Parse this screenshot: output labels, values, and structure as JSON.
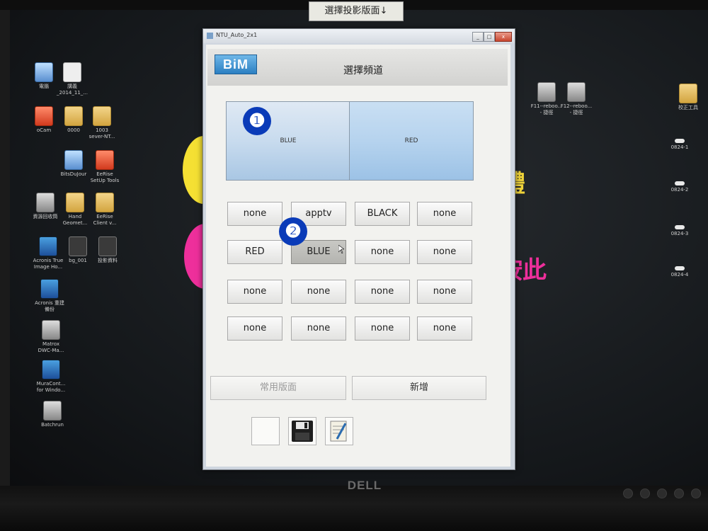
{
  "sticky_note": "選擇投影版面↓",
  "desktop_icons": [
    {
      "name": "computer-icon",
      "label": "電腦",
      "glyph": "g-pc"
    },
    {
      "name": "doc-icon",
      "label": "講義\n_2014_11_...",
      "glyph": "g-doc"
    },
    {
      "name": "ocam-icon",
      "label": "oCam",
      "glyph": "g-red"
    },
    {
      "name": "folder-icon",
      "label": "0000",
      "glyph": "g-folder"
    },
    {
      "name": "folder-icon",
      "label": "1003\nsever-NT...",
      "glyph": "g-folder"
    },
    {
      "name": "app-icon",
      "label": "BitsDuJour",
      "glyph": "g-pc"
    },
    {
      "name": "app-icon",
      "label": "EeRise\nSetUp Tools",
      "glyph": "g-red"
    },
    {
      "name": "recycle-bin-icon",
      "label": "資源回收筒",
      "glyph": "g-app"
    },
    {
      "name": "folder-icon",
      "label": "Hand\nGeomet...",
      "glyph": "g-folder"
    },
    {
      "name": "folder-icon",
      "label": "EeRise\nClient v...",
      "glyph": "g-folder"
    },
    {
      "name": "acronis-icon",
      "label": "Acronis True\nImage Ho...",
      "glyph": "g-blue"
    },
    {
      "name": "app-icon",
      "label": "bg_001",
      "glyph": "g-dark"
    },
    {
      "name": "app-icon",
      "label": "投影資料",
      "glyph": "g-dark"
    },
    {
      "name": "acronis-icon",
      "label": "Acronis 重建\n備份",
      "glyph": "g-blue"
    },
    {
      "name": "matrox-icon",
      "label": "Matrox\nDWC-Ma...",
      "glyph": "g-app"
    },
    {
      "name": "muracontrol-icon",
      "label": "MuraCont...\nfor Windo...",
      "glyph": "g-blue"
    },
    {
      "name": "batch-icon",
      "label": "Batchrun",
      "glyph": "g-app"
    },
    {
      "name": "shortcut-icon",
      "label": "F11--reboo...\n- 捷徑",
      "glyph": "g-app"
    },
    {
      "name": "shortcut-icon",
      "label": "F12--reboo...\n- 捷徑",
      "glyph": "g-app"
    },
    {
      "name": "folder-icon",
      "label": "校正工具",
      "glyph": "g-folder"
    },
    {
      "name": "file-icon",
      "label": "0824-1",
      "glyph": "g-bar"
    },
    {
      "name": "file-icon",
      "label": "0824-2",
      "glyph": "g-bar"
    },
    {
      "name": "file-icon",
      "label": "0824-3",
      "glyph": "g-bar"
    },
    {
      "name": "file-icon",
      "label": "0824-4",
      "glyph": "g-bar"
    }
  ],
  "wallpaper": {
    "text_1": "體",
    "text_2": "按此"
  },
  "window": {
    "title": "NTU_Auto_2x1",
    "logo": "BiM",
    "page_title": "選擇頻道",
    "preview_left": "BLUE",
    "preview_right": "RED",
    "badge_1": "❶",
    "badge_2": "❷",
    "sources": [
      [
        "none",
        "apptv",
        "BLACK",
        "none"
      ],
      [
        "RED",
        "BLUE",
        "none",
        "none"
      ],
      [
        "none",
        "none",
        "none",
        "none"
      ],
      [
        "none",
        "none",
        "none",
        "none"
      ]
    ],
    "active_source": "BLUE",
    "favorites_button": "常用版面",
    "add_button": "新增",
    "min_glyph": "_",
    "max_glyph": "□",
    "close_glyph": "x"
  },
  "monitor_brand": "DELL",
  "colors": {
    "accent": "#0a3bb8",
    "yellow_circle": "#f5e033",
    "pink_circle": "#ee2f9b"
  }
}
